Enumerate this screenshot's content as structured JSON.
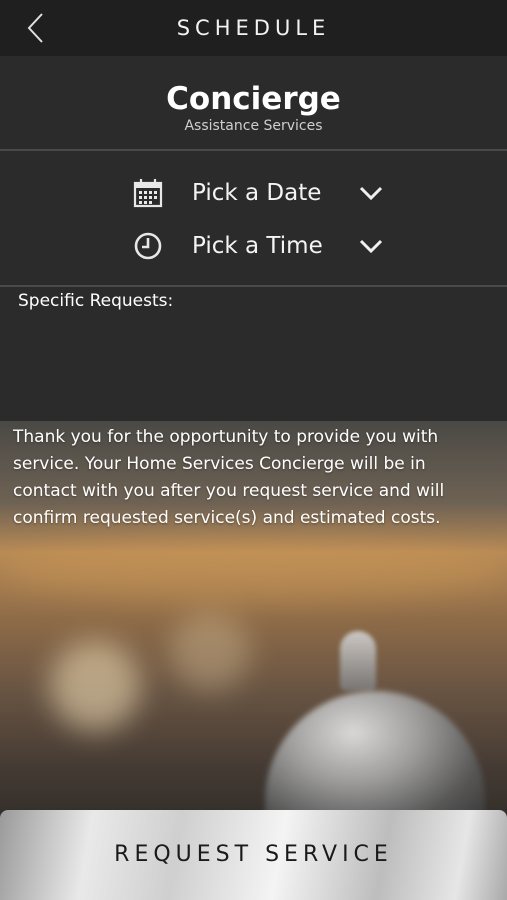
{
  "topbar": {
    "title": "SCHEDULE",
    "back_icon": "chevron-left-icon"
  },
  "header": {
    "title": "Concierge",
    "subtitle": "Assistance Services"
  },
  "pickers": {
    "date": {
      "label": "Pick a Date",
      "icon": "calendar-icon",
      "chevron": "chevron-down-icon"
    },
    "time": {
      "label": "Pick a Time",
      "icon": "clock-icon",
      "chevron": "chevron-down-icon"
    }
  },
  "requests": {
    "label": "Specific Requests:",
    "value": ""
  },
  "info": {
    "text": "Thank you for the opportunity to provide you with service. Your Home Services Concierge will be in contact with you after you request service and will confirm requested service(s) and estimated costs."
  },
  "action": {
    "label": "REQUEST SERVICE"
  },
  "colors": {
    "background": "#2b2b2b",
    "topbar": "#1f1f1f",
    "divider": "#4a4a4a",
    "button_text": "#1a1a1a"
  }
}
